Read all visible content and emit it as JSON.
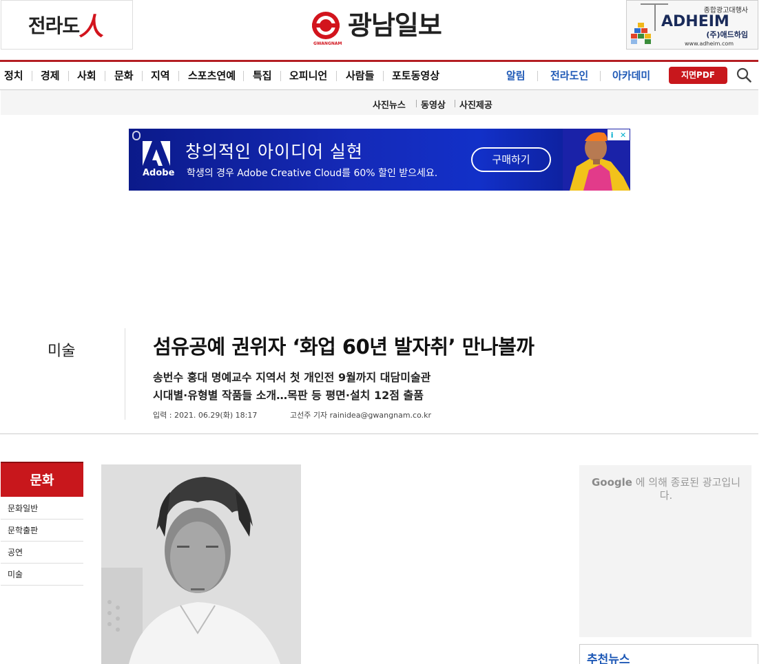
{
  "header": {
    "left_logo_text": "전라도",
    "left_logo_mark": "人",
    "site_name": "광남일보",
    "site_name_en": "GWANGNAM",
    "ad": {
      "tag": "종합광고대행사",
      "brand": "ADHEIM",
      "brand_kr": "(주)애드하임",
      "url": "www.adheim.com"
    }
  },
  "nav": {
    "items": [
      "정치",
      "경제",
      "사회",
      "문화",
      "지역",
      "스포츠연예",
      "특집",
      "오피니언",
      "사람들",
      "포토동영상"
    ],
    "right_items": [
      "알림",
      "전라도인",
      "아카데미"
    ],
    "pdf_label": "지면PDF"
  },
  "subnav": {
    "items": [
      "사진뉴스",
      "동영상",
      "사진제공"
    ]
  },
  "banner_ad": {
    "brand": "Adobe",
    "headline": "창의적인 아이디어 실현",
    "subline": "학생의 경우 Adobe Creative Cloud를 60% 할인 받으세요.",
    "cta": "구매하기",
    "info_icon": "i",
    "close_icon": "✕"
  },
  "article": {
    "section": "미술",
    "title": "섬유공예 권위자 ‘화업 60년 발자취’ 만나볼까",
    "subtitles": [
      "송번수 홍대 명예교수 지역서 첫 개인전 9월까지 대담미술관",
      "시대별·유형별 작품들 소개…목판 등 평면·설치 12점 출품"
    ],
    "date": "입력 : 2021. 06.29(화) 18:17",
    "byline": "고선주 기자 rainidea@gwangnam.co.kr"
  },
  "sidebar": {
    "title": "문화",
    "items": [
      "문화일반",
      "문학출판",
      "공연",
      "미술"
    ]
  },
  "right_ad": {
    "google": "Google",
    "text": "에 의해 종료된 광고입니다."
  },
  "recommend": {
    "title": "추천뉴스"
  },
  "colors": {
    "brand_red": "#c8171c",
    "nav_blue": "#1d58b6"
  }
}
